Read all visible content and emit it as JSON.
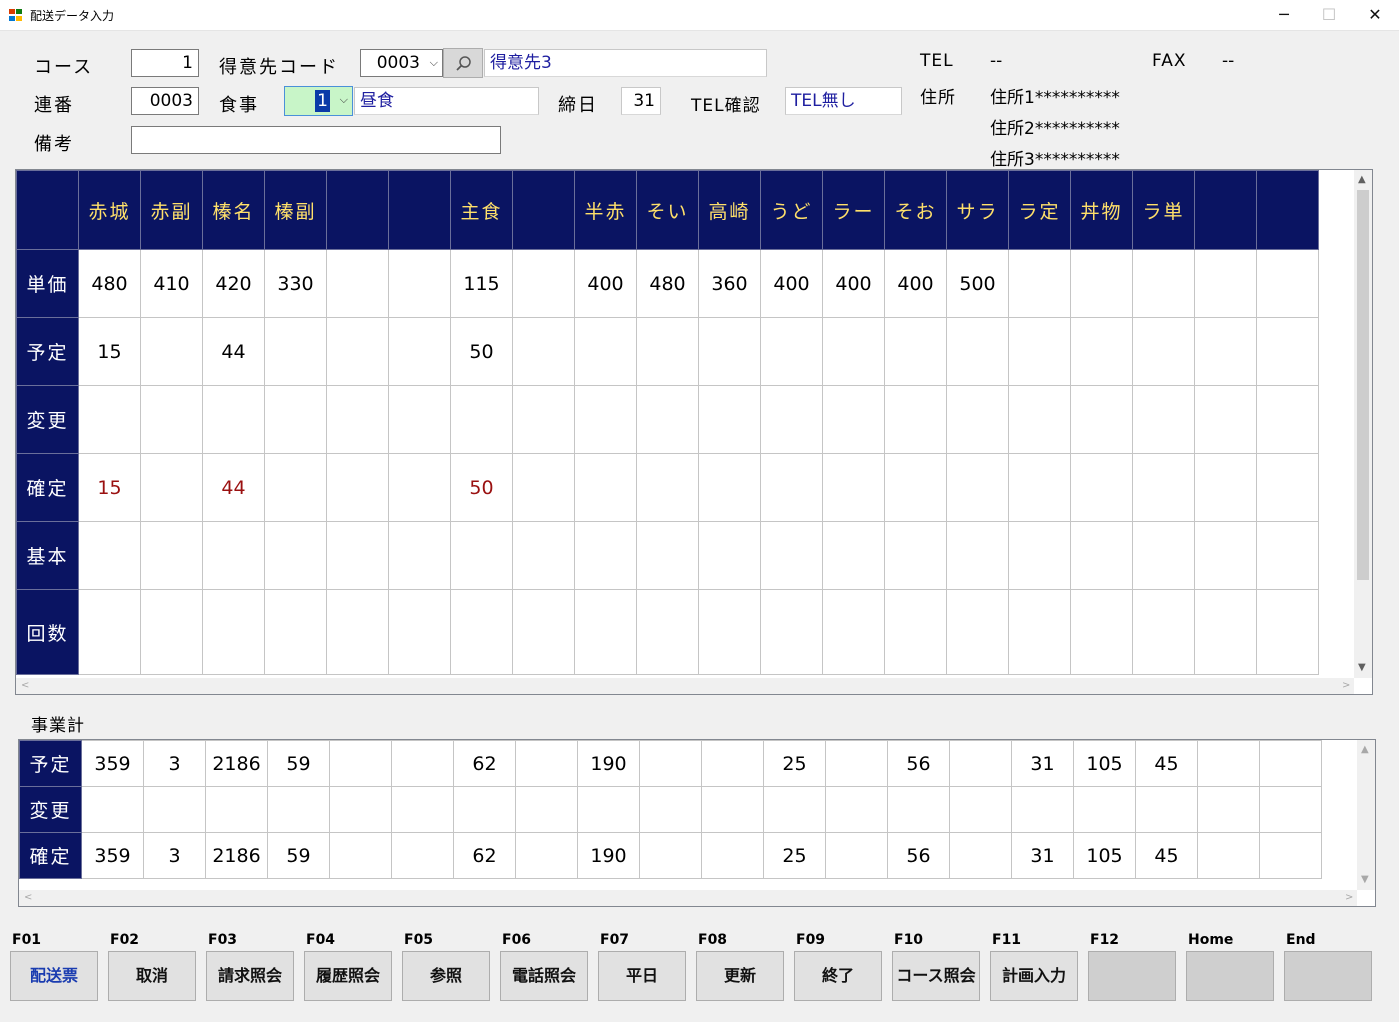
{
  "window": {
    "title": "配送データ入力",
    "minimize": "─",
    "maximize": "☐",
    "close": "✕"
  },
  "form": {
    "course_label": "コース",
    "course_value": "1",
    "customer_code_label": "得意先コード",
    "customer_code_value": "0003",
    "customer_name": "得意先3",
    "serial_label": "連番",
    "serial_value": "0003",
    "meal_label": "食事",
    "meal_value": "1",
    "meal_name": "昼食",
    "closing_label": "締日",
    "closing_value": "31",
    "tel_confirm_label": "TEL確認",
    "tel_confirm_value": "TEL無し",
    "remarks_label": "備考",
    "remarks_value": "",
    "tel_label": "TEL",
    "tel_value": "--",
    "fax_label": "FAX",
    "fax_value": "--",
    "address_label": "住所",
    "address1": "住所1**********",
    "address2": "住所2**********",
    "address3": "住所3**********"
  },
  "main_grid": {
    "columns": [
      "赤城",
      "赤副",
      "榛名",
      "榛副",
      "",
      "",
      "主食",
      "",
      "半赤",
      "そい",
      "高崎",
      "うど",
      "ラー",
      "そお",
      "サラ",
      "ラ定",
      "丼物",
      "ラ単",
      "",
      ""
    ],
    "rows": [
      {
        "label": "単価",
        "cells": [
          "480",
          "410",
          "420",
          "330",
          "",
          "",
          "115",
          "",
          "400",
          "480",
          "360",
          "400",
          "400",
          "400",
          "500",
          "",
          "",
          "",
          "",
          ""
        ]
      },
      {
        "label": "予定",
        "cells": [
          "15",
          "",
          "44",
          "",
          "",
          "",
          "50",
          "",
          "",
          "",
          "",
          "",
          "",
          "",
          "",
          "",
          "",
          "",
          "",
          ""
        ]
      },
      {
        "label": "変更",
        "cells": [
          "",
          "",
          "",
          "",
          "",
          "",
          "",
          "",
          "",
          "",
          "",
          "",
          "",
          "",
          "",
          "",
          "",
          "",
          "",
          ""
        ]
      },
      {
        "label": "確定",
        "cells": [
          "15",
          "",
          "44",
          "",
          "",
          "",
          "50",
          "",
          "",
          "",
          "",
          "",
          "",
          "",
          "",
          "",
          "",
          "",
          "",
          ""
        ],
        "color": "#9a1010"
      },
      {
        "label": "基本",
        "cells": [
          "",
          "",
          "",
          "",
          "",
          "",
          "",
          "",
          "",
          "",
          "",
          "",
          "",
          "",
          "",
          "",
          "",
          "",
          "",
          ""
        ]
      },
      {
        "label": "回数",
        "cells": [
          "",
          "",
          "",
          "",
          "",
          "",
          "",
          "",
          "",
          "",
          "",
          "",
          "",
          "",
          "",
          "",
          "",
          "",
          "",
          ""
        ]
      }
    ]
  },
  "business_total": {
    "label": "事業計",
    "rows": [
      {
        "label": "予定",
        "cells": [
          "359",
          "3",
          "2186",
          "59",
          "",
          "",
          "62",
          "",
          "190",
          "",
          "",
          "25",
          "",
          "56",
          "",
          "31",
          "105",
          "45",
          "",
          ""
        ]
      },
      {
        "label": "変更",
        "cells": [
          "",
          "",
          "",
          "",
          "",
          "",
          "",
          "",
          "",
          "",
          "",
          "",
          "",
          "",
          "",
          "",
          "",
          "",
          "",
          ""
        ]
      },
      {
        "label": "確定",
        "cells": [
          "359",
          "3",
          "2186",
          "59",
          "",
          "",
          "62",
          "",
          "190",
          "",
          "",
          "25",
          "",
          "56",
          "",
          "31",
          "105",
          "45",
          "",
          ""
        ]
      }
    ]
  },
  "function_keys": [
    {
      "key": "F01",
      "label": "配送票"
    },
    {
      "key": "F02",
      "label": "取消"
    },
    {
      "key": "F03",
      "label": "請求照会"
    },
    {
      "key": "F04",
      "label": "履歴照会"
    },
    {
      "key": "F05",
      "label": "参照"
    },
    {
      "key": "F06",
      "label": "電話照会"
    },
    {
      "key": "F07",
      "label": "平日"
    },
    {
      "key": "F08",
      "label": "更新"
    },
    {
      "key": "F09",
      "label": "終了"
    },
    {
      "key": "F10",
      "label": "コース照会"
    },
    {
      "key": "F11",
      "label": "計画入力"
    },
    {
      "key": "F12",
      "label": ""
    },
    {
      "key": "Home",
      "label": ""
    },
    {
      "key": "End",
      "label": ""
    }
  ],
  "scroll": {
    "up": "▲",
    "down": "▼",
    "left": "<",
    "right": ">"
  },
  "colors": {
    "grid_header_bg": "#0a1462",
    "grid_header_text": "#ffe06a",
    "confirmed_text": "#9a1010",
    "meal_highlight": "#c8f5c8"
  }
}
